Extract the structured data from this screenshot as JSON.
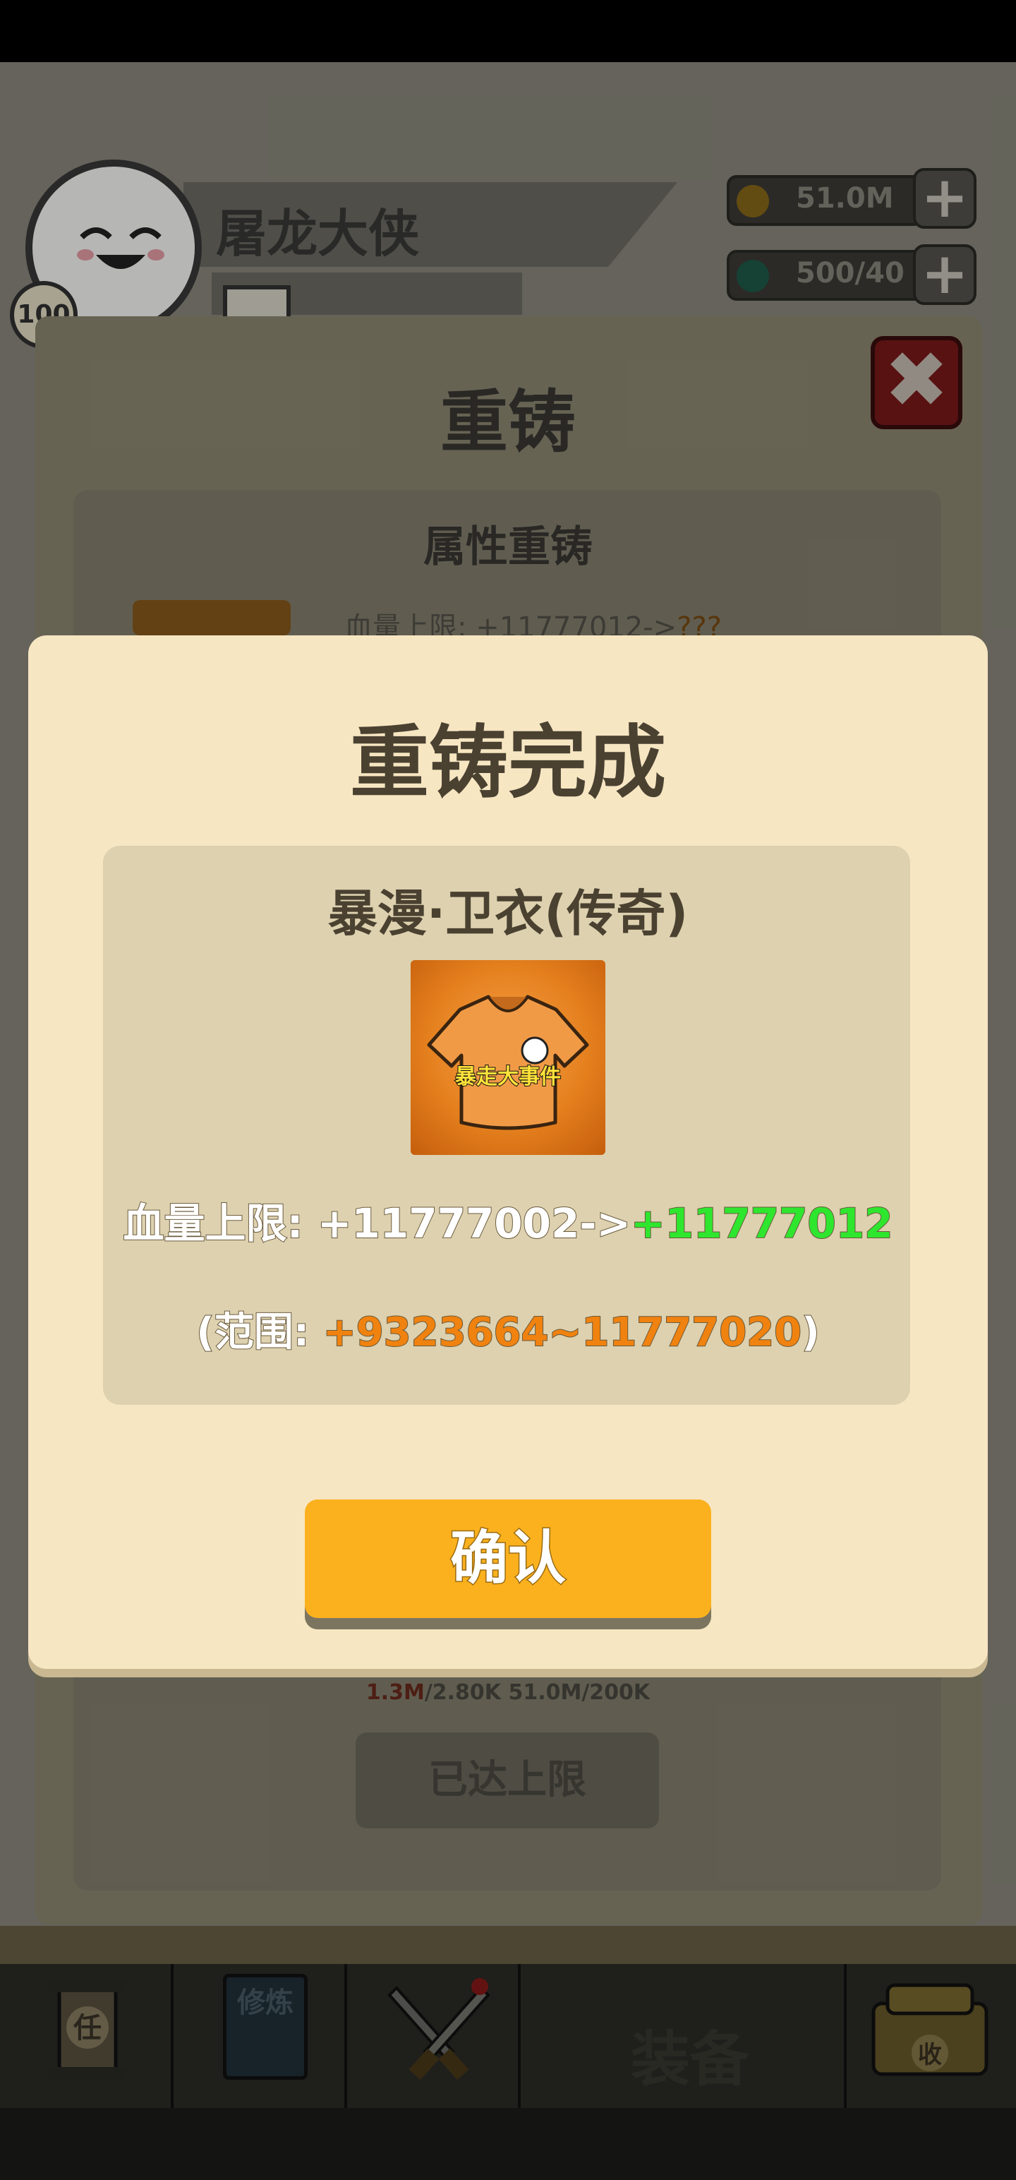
{
  "player": {
    "name": "屠龙大侠",
    "level": "100"
  },
  "resources": {
    "gold": "51.0M",
    "energy": "500/40"
  },
  "recast_panel": {
    "title": "重铸",
    "section_title": "属性重铸",
    "stat_preview": "血量上限: +11777012->",
    "stat_preview_unknown": "???",
    "cost_prefix": "1.3M",
    "cost_suffix": "/2.80K  51.0M/200K",
    "limit_button": "已达上限"
  },
  "nav": {
    "book_label": "修炼",
    "scroll_label": "任",
    "equip_label": "装备",
    "bag_label": "收"
  },
  "dialog": {
    "title": "重铸完成",
    "item_name": "暴漫·卫衣(传奇)",
    "stat_prefix": "血量上限: +11777002->",
    "stat_new": "+11777012",
    "range_prefix": "(范围: ",
    "range_value": "+9323664~11777020",
    "range_suffix": ")",
    "confirm_label": "确认",
    "item_print": "暴走大事件"
  },
  "colors": {
    "dialog_bg": "#f7e6c2",
    "confirm": "#fbb11e",
    "new_value": "#2fe62f",
    "range": "#f0820f"
  }
}
